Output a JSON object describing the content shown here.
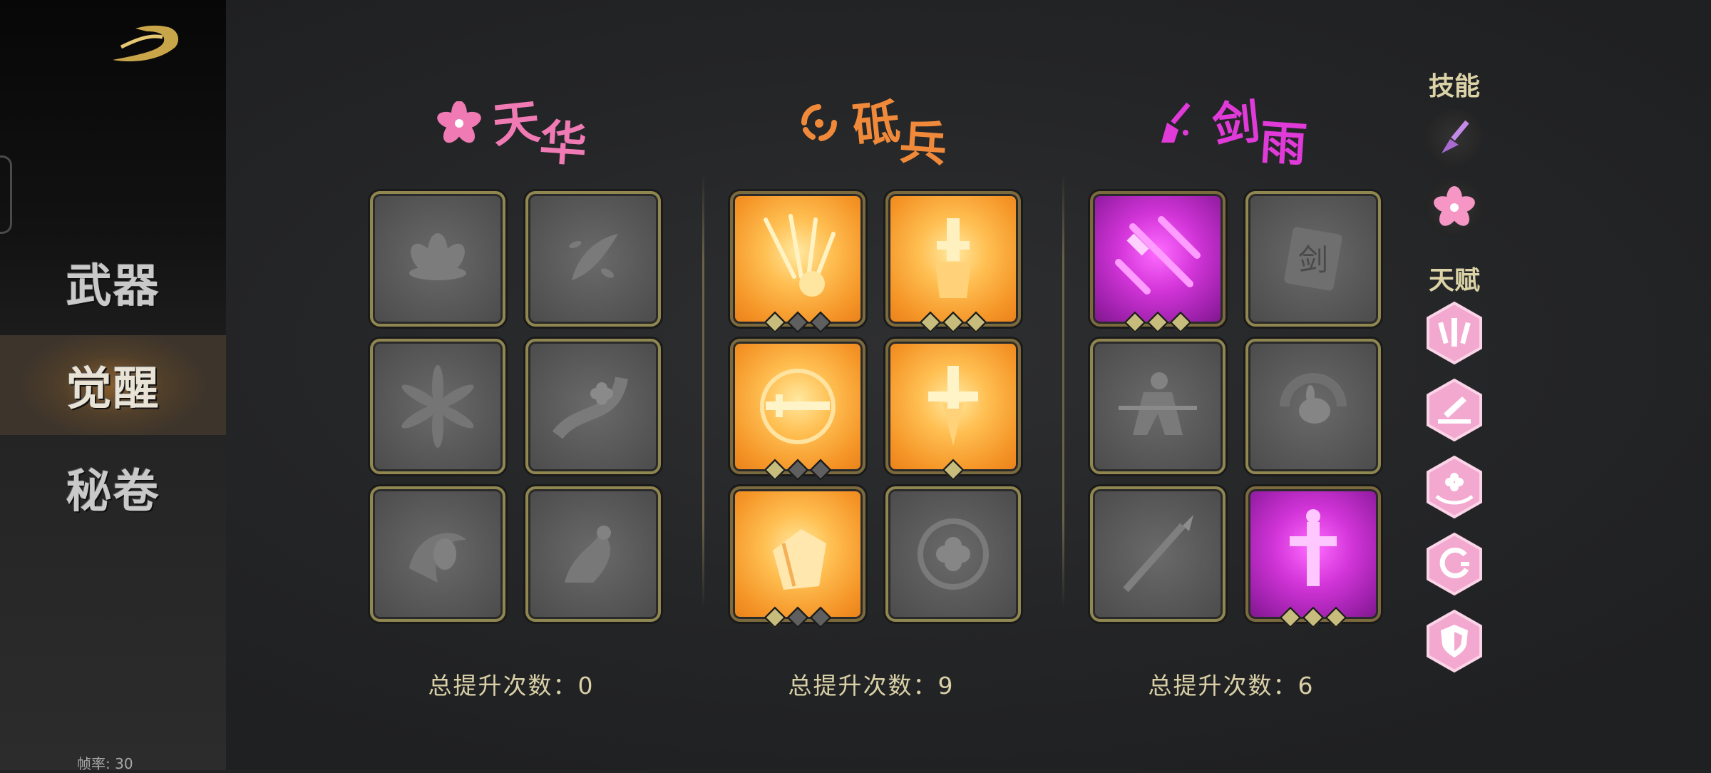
{
  "sidebar": {
    "nav": [
      {
        "label": "武器"
      },
      {
        "label": "觉醒",
        "active": true
      },
      {
        "label": "秘卷"
      }
    ],
    "fps": "帧率: 30"
  },
  "columns": [
    {
      "title": "天华",
      "title_color": "#f07ab4",
      "icon": "cherry-blossom-icon",
      "total": "总提升次数：0",
      "tiles": [
        {
          "icon": "lotus-icon",
          "state": "locked"
        },
        {
          "icon": "petals-icon",
          "state": "locked"
        },
        {
          "icon": "petal-burst-icon",
          "state": "locked"
        },
        {
          "icon": "flower-swirl-icon",
          "state": "locked"
        },
        {
          "icon": "blossom-wind-icon",
          "state": "locked"
        },
        {
          "icon": "dancer-blossom-icon",
          "state": "locked"
        }
      ]
    },
    {
      "title": "砥兵",
      "title_color": "#f08a3a",
      "icon": "circle-swirl-icon",
      "total": "总提升次数：9",
      "tiles": [
        {
          "icon": "sword-rain-icon",
          "state": "fire",
          "level": 1,
          "max": 3
        },
        {
          "icon": "sword-fist-icon",
          "state": "fire",
          "level": 3,
          "max": 3
        },
        {
          "icon": "sword-orb-icon",
          "state": "fire",
          "level": 1,
          "max": 3
        },
        {
          "icon": "flaming-sword-icon",
          "state": "fire",
          "level": 1,
          "max": 1
        },
        {
          "icon": "fist-icon",
          "state": "fire",
          "level": 1,
          "max": 3
        },
        {
          "icon": "sword-flower-icon",
          "state": "locked"
        }
      ]
    },
    {
      "title": "剑雨",
      "title_color": "#e03ad8",
      "icon": "sword-strike-icon",
      "total": "总提升次数：6",
      "tiles": [
        {
          "icon": "falling-swords-icon",
          "state": "purple",
          "level": 3,
          "max": 3
        },
        {
          "icon": "sword-tablet-icon",
          "state": "locked"
        },
        {
          "icon": "sword-dash-icon",
          "state": "locked"
        },
        {
          "icon": "rabbit-swirl-icon",
          "state": "locked"
        },
        {
          "icon": "spear-icon",
          "state": "locked"
        },
        {
          "icon": "great-sword-icon",
          "state": "purple",
          "level": 3,
          "max": 3
        }
      ]
    }
  ],
  "right_panel": {
    "skills_label": "技能",
    "skills": [
      {
        "icon": "purple-dagger-icon"
      },
      {
        "icon": "pink-flower-icon"
      }
    ],
    "talents_label": "天赋",
    "talents": [
      {
        "icon": "triple-sword-icon"
      },
      {
        "icon": "slash-icon"
      },
      {
        "icon": "flower-hand-icon"
      },
      {
        "icon": "swirl-icon"
      },
      {
        "icon": "shield-icon"
      }
    ]
  }
}
